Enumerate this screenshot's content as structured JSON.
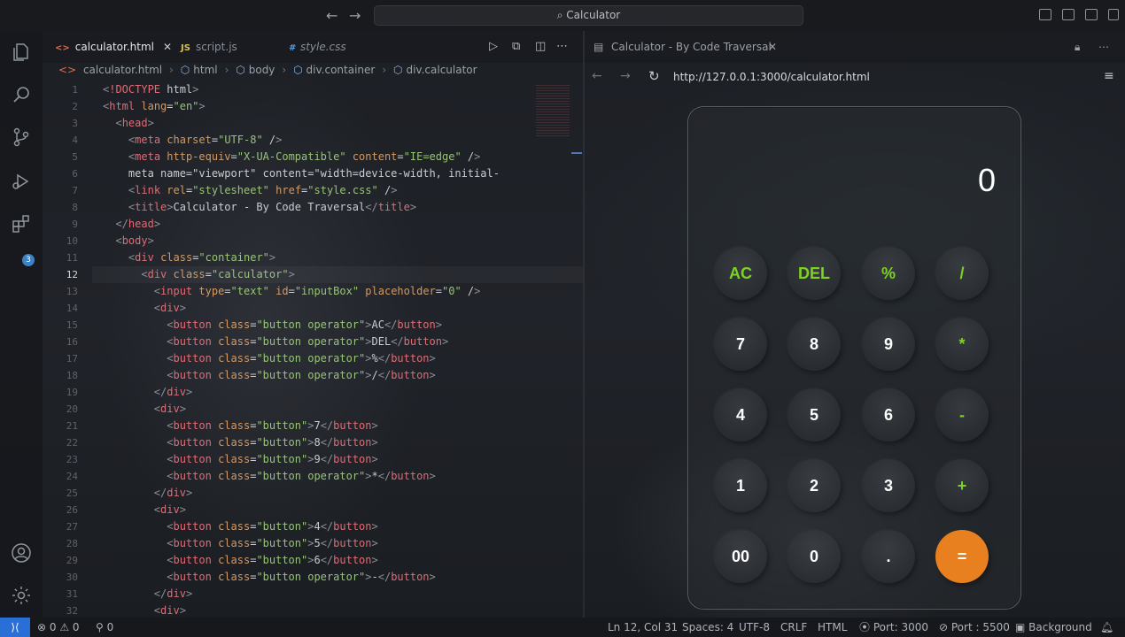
{
  "titlebar": {
    "search_text": "Calculator"
  },
  "tabs": [
    {
      "label": "calculator.html",
      "icon": "<>",
      "active": true
    },
    {
      "label": "script.js",
      "icon": "JS",
      "active": false
    },
    {
      "label": "style.css",
      "icon": "#",
      "active": false
    }
  ],
  "breadcrumb": [
    "calculator.html",
    "html",
    "body",
    "div.container",
    "div.calculator"
  ],
  "code": {
    "current_line": 12,
    "lines": [
      "<!DOCTYPE html>",
      "<html lang=\"en\">",
      "  <head>",
      "    <meta charset=\"UTF-8\" />",
      "    <meta http-equiv=\"X-UA-Compatible\" content=\"IE=edge\" />",
      "    <meta name=\"viewport\" content=\"width=device-width, initial-",
      "    <link rel=\"stylesheet\" href=\"style.css\" />",
      "    <title>Calculator - By Code Traversal</title>",
      "  </head>",
      "  <body>",
      "    <div class=\"container\">",
      "      <div class=\"calculator\">",
      "        <input type=\"text\" id=\"inputBox\" placeholder=\"0\" />",
      "        <div>",
      "          <button class=\"button operator\">AC</button>",
      "          <button class=\"button operator\">DEL</button>",
      "          <button class=\"button operator\">%</button>",
      "          <button class=\"button operator\">/</button>",
      "        </div>",
      "        <div>",
      "          <button class=\"button\">7</button>",
      "          <button class=\"button\">8</button>",
      "          <button class=\"button\">9</button>",
      "          <button class=\"button operator\">*</button>",
      "        </div>",
      "        <div>",
      "          <button class=\"button\">4</button>",
      "          <button class=\"button\">5</button>",
      "          <button class=\"button\">6</button>",
      "          <button class=\"button operator\">-</button>",
      "        </div>",
      "        <div>"
    ]
  },
  "preview": {
    "tab_label": "Calculator - By Code Traversal",
    "url": "http://127.0.0.1:3000/calculator.html"
  },
  "calculator": {
    "display": "0",
    "rows": [
      [
        {
          "label": "AC",
          "kind": "op"
        },
        {
          "label": "DEL",
          "kind": "op"
        },
        {
          "label": "%",
          "kind": "op"
        },
        {
          "label": "/",
          "kind": "op"
        }
      ],
      [
        {
          "label": "7",
          "kind": "num"
        },
        {
          "label": "8",
          "kind": "num"
        },
        {
          "label": "9",
          "kind": "num"
        },
        {
          "label": "*",
          "kind": "op"
        }
      ],
      [
        {
          "label": "4",
          "kind": "num"
        },
        {
          "label": "5",
          "kind": "num"
        },
        {
          "label": "6",
          "kind": "num"
        },
        {
          "label": "-",
          "kind": "op"
        }
      ],
      [
        {
          "label": "1",
          "kind": "num"
        },
        {
          "label": "2",
          "kind": "num"
        },
        {
          "label": "3",
          "kind": "num"
        },
        {
          "label": "+",
          "kind": "op"
        }
      ],
      [
        {
          "label": "00",
          "kind": "num"
        },
        {
          "label": "0",
          "kind": "num"
        },
        {
          "label": ".",
          "kind": "num"
        },
        {
          "label": "=",
          "kind": "eq"
        }
      ]
    ],
    "colors": {
      "operator": "#7ed321",
      "equals": "#e8801f"
    }
  },
  "activity_bar": {
    "extensions_badge": "3"
  },
  "statusbar": {
    "errors": "0",
    "warnings": "0",
    "ports_forwarded": "0",
    "position": "Ln 12, Col 31",
    "spaces": "Spaces: 4",
    "encoding": "UTF-8",
    "eol": "CRLF",
    "language": "HTML",
    "port_3000": "Port: 3000",
    "port_5500": "Port : 5500",
    "background": "Background"
  }
}
